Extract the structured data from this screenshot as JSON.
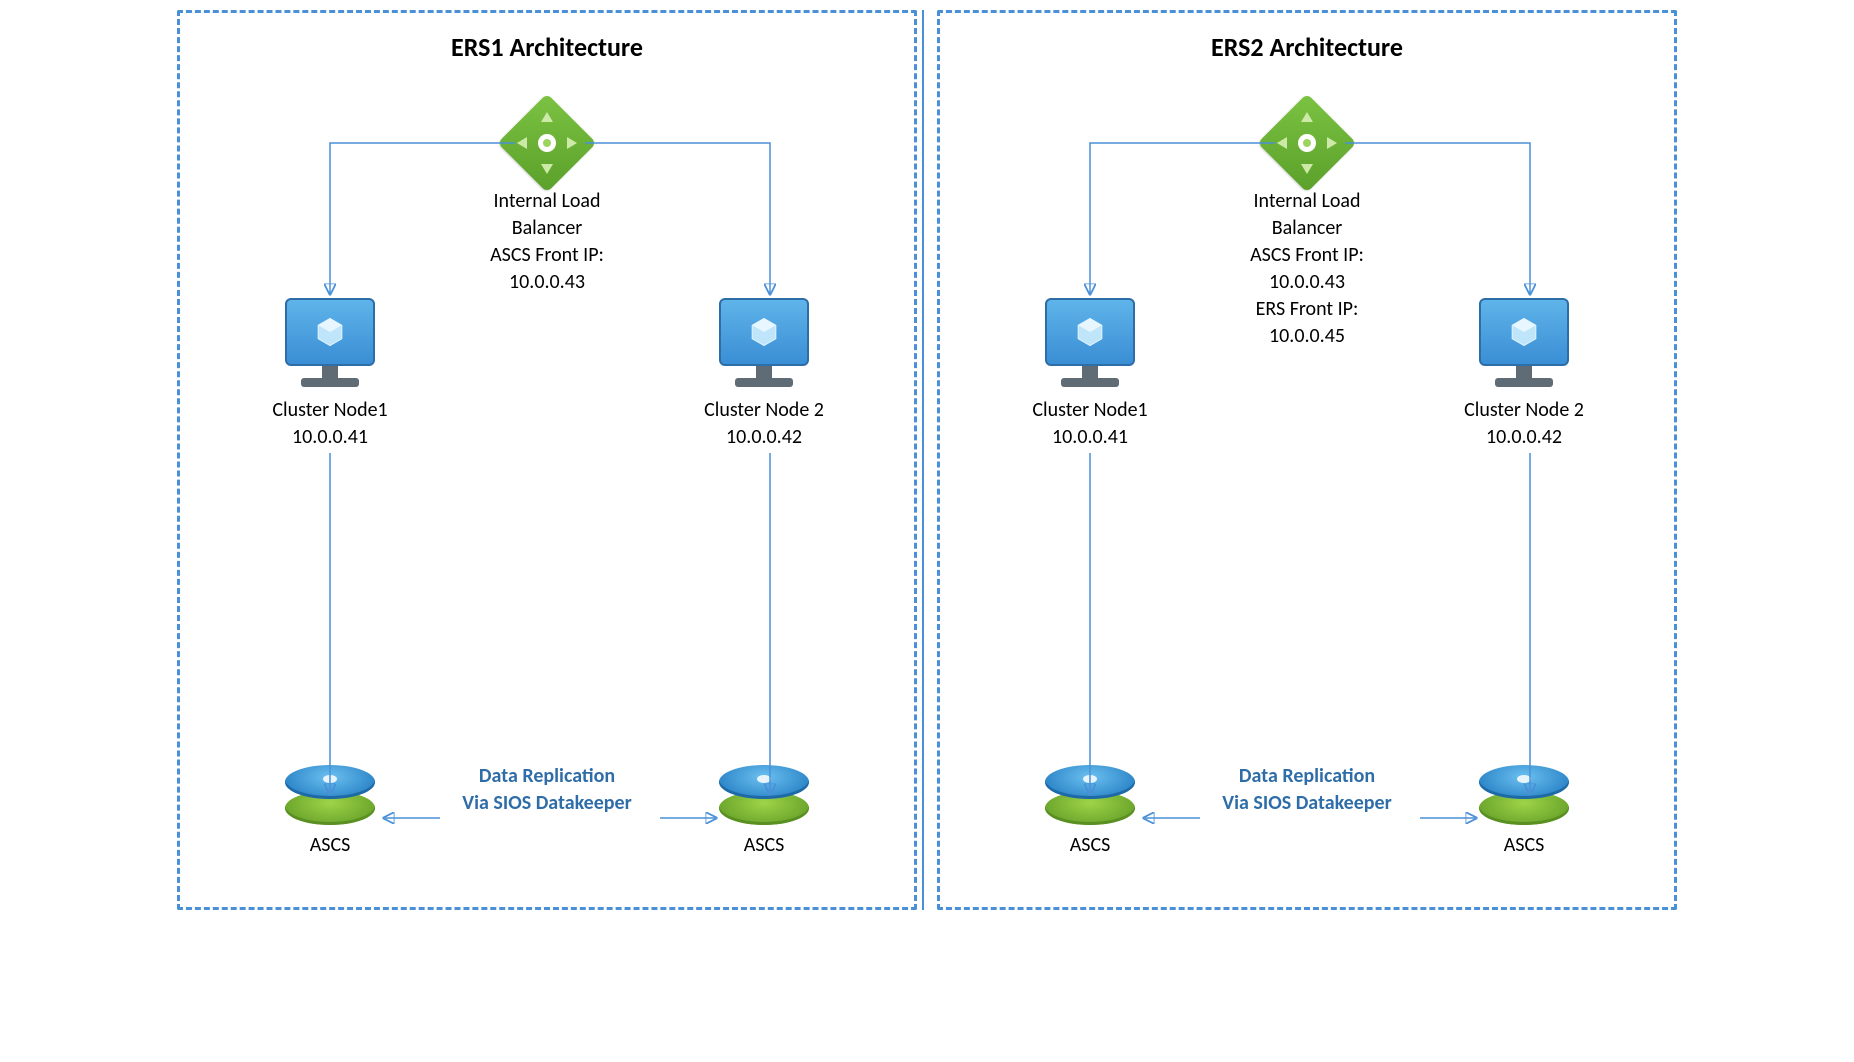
{
  "diagrams": [
    {
      "title": "ERS1 Architecture",
      "load_balancer": {
        "line1": "Internal Load",
        "line2": "Balancer",
        "line3": "ASCS Front IP:",
        "line4": "10.0.0.43",
        "line5": "",
        "line6": ""
      },
      "node_left": {
        "name": "Cluster Node1",
        "ip": "10.0.0.41"
      },
      "node_right": {
        "name": "Cluster Node 2",
        "ip": "10.0.0.42"
      },
      "disk_left": {
        "label": "ASCS"
      },
      "disk_right": {
        "label": "ASCS"
      },
      "replication": {
        "line1": "Data Replication",
        "line2": "Via SIOS Datakeeper"
      }
    },
    {
      "title": "ERS2 Architecture",
      "load_balancer": {
        "line1": "Internal Load",
        "line2": "Balancer",
        "line3": "ASCS Front IP:",
        "line4": "10.0.0.43",
        "line5": "ERS Front IP:",
        "line6": "10.0.0.45"
      },
      "node_left": {
        "name": "Cluster Node1",
        "ip": "10.0.0.41"
      },
      "node_right": {
        "name": "Cluster Node 2",
        "ip": "10.0.0.42"
      },
      "disk_left": {
        "label": "ASCS"
      },
      "disk_right": {
        "label": "ASCS"
      },
      "replication": {
        "line1": "Data Replication",
        "line2": "Via SIOS Datakeeper"
      }
    }
  ]
}
